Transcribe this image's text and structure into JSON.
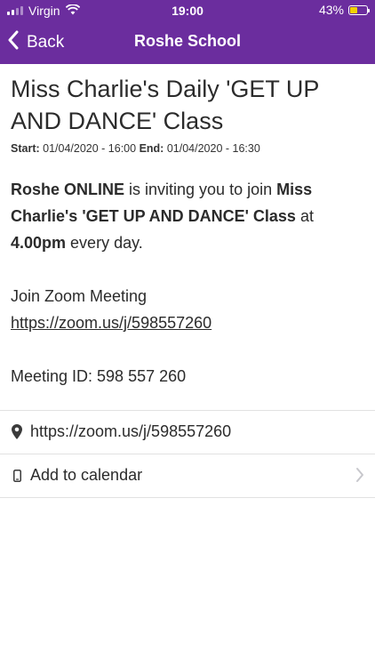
{
  "status_bar": {
    "carrier": "Virgin",
    "time": "19:00",
    "battery_percent": "43%",
    "battery_level": 0.43,
    "battery_color": "#f2d200"
  },
  "nav": {
    "back_label": "Back",
    "title": "Roshe School",
    "color": "#6b2d9e"
  },
  "event": {
    "title": "Miss Charlie's Daily 'GET UP AND DANCE' Class",
    "start_label": "Start:",
    "start_value": "01/04/2020 - 16:00",
    "end_label": "End:",
    "end_value": "01/04/2020 - 16:30",
    "description": {
      "part1_bold": "Roshe ONLINE",
      "part2": " is inviting you to join ",
      "part3_bold": "Miss Charlie's 'GET UP AND DANCE' Class",
      "part4": " at ",
      "part5_bold": "4.00pm",
      "part6": " every day.",
      "join_label": "Join Zoom Meeting",
      "join_link": "https://zoom.us/j/598557260",
      "meeting_id": "Meeting ID: 598 557 260"
    },
    "location_link": "https://zoom.us/j/598557260",
    "add_to_calendar": "Add to calendar"
  },
  "icons": {
    "back": "chevron-left-icon",
    "location": "map-pin-icon",
    "calendar": "phone-icon",
    "chevron": "chevron-right-icon",
    "wifi": "wifi-icon",
    "signal": "signal-icon",
    "battery": "battery-icon"
  }
}
